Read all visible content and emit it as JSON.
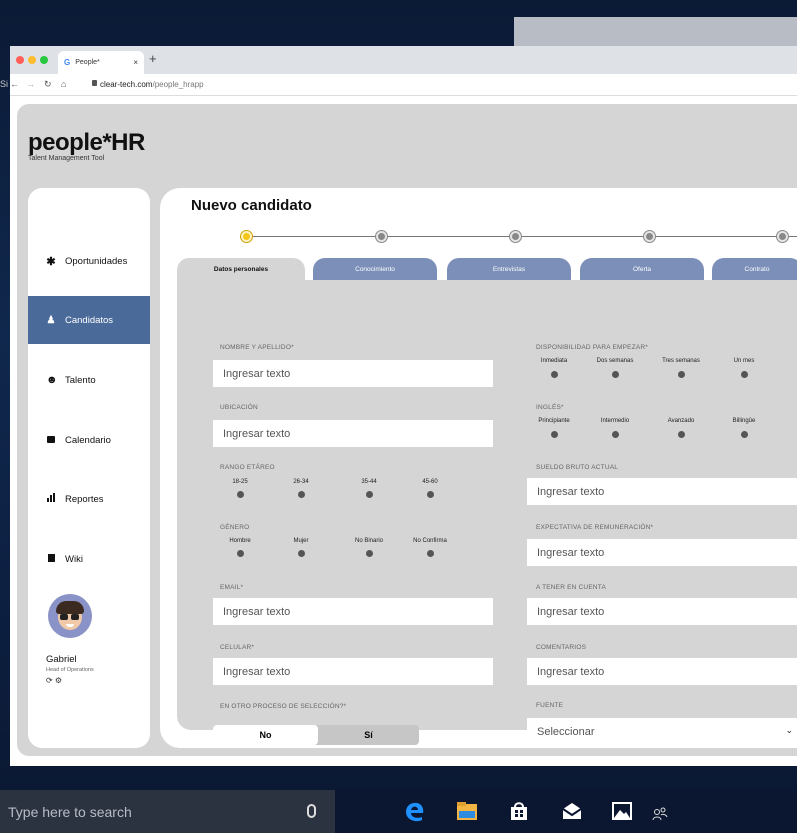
{
  "browser": {
    "tab_title": "People*",
    "tab_favicon": "G",
    "tab_close": "×",
    "new_tab": "+",
    "url_host": "clear-tech.com",
    "url_path": "/people_hrapp",
    "stray_text": "Si"
  },
  "app": {
    "logo": "people*HR",
    "tagline": "Talent Management Tool"
  },
  "sidebar": {
    "items": [
      {
        "icon": "asterisk-icon",
        "glyph": "✱",
        "label": "Oportunidades"
      },
      {
        "icon": "person-icon",
        "glyph": "🚶",
        "label": "Candidatos",
        "active": true
      },
      {
        "icon": "smiley-icon",
        "glyph": "☻",
        "label": "Talento"
      },
      {
        "icon": "calendar-icon",
        "glyph": "▬",
        "label": "Calendario"
      },
      {
        "icon": "bar-chart-icon",
        "glyph": "▐",
        "label": "Reportes"
      },
      {
        "icon": "book-icon",
        "glyph": "▮",
        "label": "Wiki"
      }
    ],
    "user": {
      "name": "Gabriel",
      "role": "Head of Operations",
      "icons": "⟳ ⚙"
    }
  },
  "main": {
    "title": "Nuevo candidato",
    "steps": 5,
    "current_step": 1,
    "tabs": [
      "Datos personales",
      "Conocimiento",
      "Entrevistas",
      "Oferta",
      "Contrato"
    ],
    "active_tab": 0
  },
  "form": {
    "nombre": {
      "label": "NOMBRE Y APELLIDO*",
      "placeholder": "Ingresar texto"
    },
    "ubicacion": {
      "label": "UBICACIÓN",
      "placeholder": "Ingresar texto"
    },
    "rango": {
      "label": "RANGO ETÁREO",
      "options": [
        "18-25",
        "26-34",
        "35-44",
        "45-60"
      ]
    },
    "genero": {
      "label": "GÉNERO",
      "options": [
        "Hombre",
        "Mujer",
        "No Binario",
        "No Confirma"
      ]
    },
    "email": {
      "label": "EMAIL*",
      "placeholder": "Ingresar texto"
    },
    "celular": {
      "label": "CELULAR*",
      "placeholder": "Ingresar texto"
    },
    "otro_proceso": {
      "label": "EN OTRO PROCESO DE SELECCIÓN?*",
      "no": "No",
      "si": "Sí",
      "selected": "No"
    },
    "disponibilidad": {
      "label": "DISPONIBILIDAD PARA EMPEZAR*",
      "options": [
        "Inmediata",
        "Dos semanas",
        "Tres semanas",
        "Un mes"
      ]
    },
    "ingles": {
      "label": "INGLÉS*",
      "options": [
        "Principiante",
        "Intermedio",
        "Avanzado",
        "Billingûe"
      ]
    },
    "sueldo": {
      "label": "SUELDO BRUTO ACTUAL",
      "placeholder": "Ingresar texto"
    },
    "expectativa": {
      "label": "EXPECTATIVA DE REMUNERACIÓN*",
      "placeholder": "Ingresar texto"
    },
    "tener_cuenta": {
      "label": "A TENER EN CUENTA",
      "placeholder": "Ingresar texto"
    },
    "comentarios": {
      "label": "COMENTARIOS",
      "placeholder": "Ingresar texto"
    },
    "fuente": {
      "label": "FUENTE",
      "placeholder": "Seleccionar",
      "arrow": "⌄"
    }
  },
  "taskbar": {
    "search_placeholder": "Type here to search"
  }
}
